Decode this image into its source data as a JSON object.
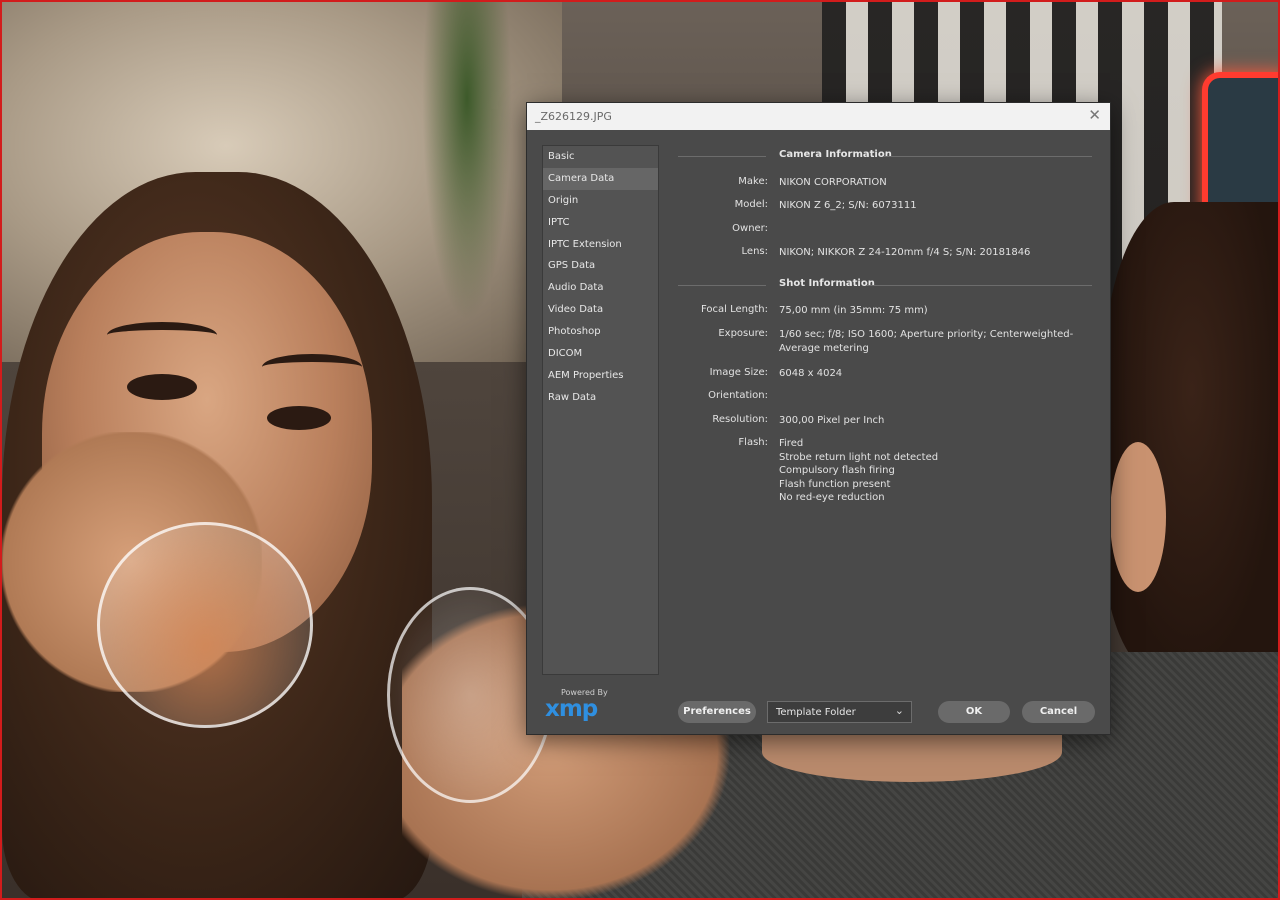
{
  "dialog": {
    "title": "_Z626129.JPG",
    "close_glyph": "✕"
  },
  "sidebar": {
    "items": [
      {
        "label": "Basic",
        "active": false
      },
      {
        "label": "Camera Data",
        "active": true
      },
      {
        "label": "Origin",
        "active": false
      },
      {
        "label": "IPTC",
        "active": false
      },
      {
        "label": "IPTC Extension",
        "active": false
      },
      {
        "label": "GPS Data",
        "active": false
      },
      {
        "label": "Audio Data",
        "active": false
      },
      {
        "label": "Video Data",
        "active": false
      },
      {
        "label": "Photoshop",
        "active": false
      },
      {
        "label": "DICOM",
        "active": false
      },
      {
        "label": "AEM Properties",
        "active": false
      },
      {
        "label": "Raw Data",
        "active": false
      }
    ]
  },
  "camera_info": {
    "header": "Camera Information",
    "make_label": "Make:",
    "make_value": "NIKON CORPORATION",
    "model_label": "Model:",
    "model_value": "NIKON Z 6_2;   S/N: 6073111",
    "owner_label": "Owner:",
    "owner_value": "",
    "lens_label": "Lens:",
    "lens_value": "NIKON;   NIKKOR Z 24-120mm f/4 S;   S/N: 20181846"
  },
  "shot_info": {
    "header": "Shot Information",
    "focal_label": "Focal Length:",
    "focal_value": "75,00 mm   (in 35mm: 75 mm)",
    "exposure_label": "Exposure:",
    "exposure_line1": "1/60 sec;   f/8;   ISO 1600;   Aperture priority;   Centerweighted-",
    "exposure_line2": "Average metering",
    "size_label": "Image Size:",
    "size_value": "6048 x 4024",
    "orientation_label": "Orientation:",
    "orientation_value": "",
    "resolution_label": "Resolution:",
    "resolution_value": "300,00 Pixel per Inch",
    "flash_label": "Flash:",
    "flash_lines": [
      "Fired",
      "Strobe return light not detected",
      "Compulsory flash firing",
      "Flash function present",
      "No red-eye reduction"
    ]
  },
  "footer": {
    "powered_by": "Powered By",
    "logo_text": "xmp",
    "preferences_label": "Preferences",
    "template_select_value": "Template Folder",
    "ok_label": "OK",
    "cancel_label": "Cancel"
  },
  "colors": {
    "dialog_bg": "#4a4a4a",
    "titlebar_bg": "#f2f2f2",
    "xmp_blue": "#2f8fe0",
    "photo_border": "#d21c1c"
  }
}
